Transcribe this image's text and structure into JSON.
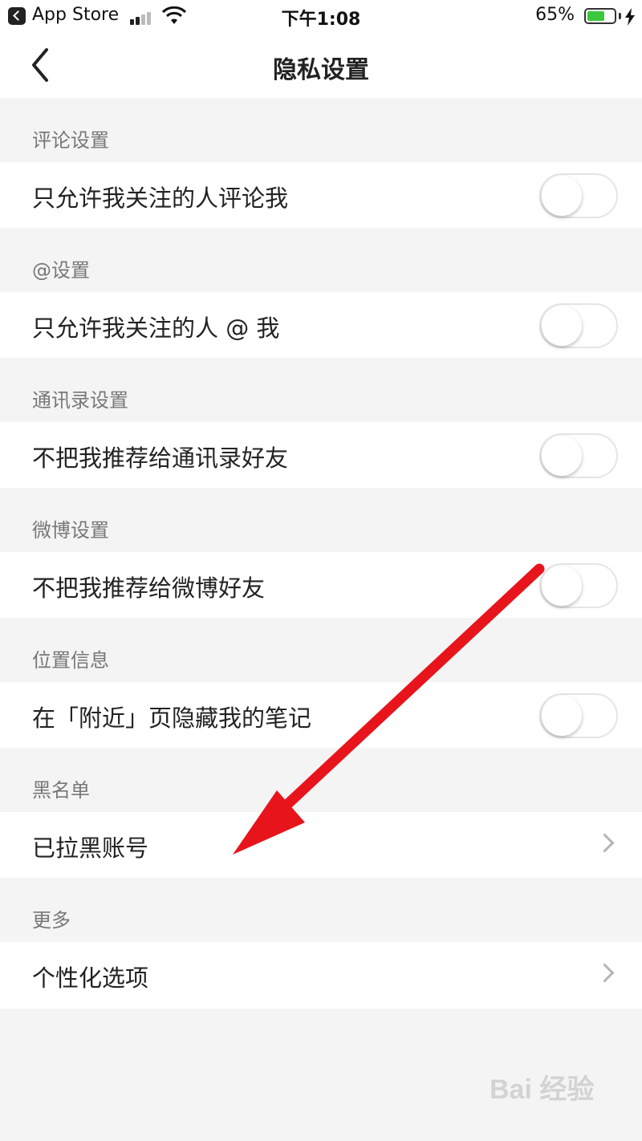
{
  "status_bar": {
    "back_app": "App Store",
    "time": "下午1:08",
    "battery_percent": "65%",
    "battery_level": 0.65,
    "battery_color": "#3cc83c",
    "icons": [
      "back-app-icon",
      "signal-icon",
      "wifi-icon",
      "battery-icon",
      "charging-bolt-icon"
    ]
  },
  "nav": {
    "title": "隐私设置",
    "back_icon": "chevron-left-icon"
  },
  "sections": [
    {
      "header": "评论设置",
      "row": "只允许我关注的人评论我",
      "control": "toggle",
      "on": false
    },
    {
      "header": "@设置",
      "row": "只允许我关注的人 @ 我",
      "control": "toggle",
      "on": false
    },
    {
      "header": "通讯录设置",
      "row": "不把我推荐给通讯录好友",
      "control": "toggle",
      "on": false
    },
    {
      "header": "微博设置",
      "row": "不把我推荐给微博好友",
      "control": "toggle",
      "on": false
    },
    {
      "header": "位置信息",
      "row": "在「附近」页隐藏我的笔记",
      "control": "toggle",
      "on": false
    },
    {
      "header": "黑名单",
      "row": "已拉黑账号",
      "control": "chevron"
    },
    {
      "header": "更多",
      "row": "个性化选项",
      "control": "chevron"
    }
  ],
  "annotation": {
    "icon": "red-arrow-icon",
    "color": "#e8141c"
  },
  "watermark": {
    "text": "Bai 经验"
  }
}
